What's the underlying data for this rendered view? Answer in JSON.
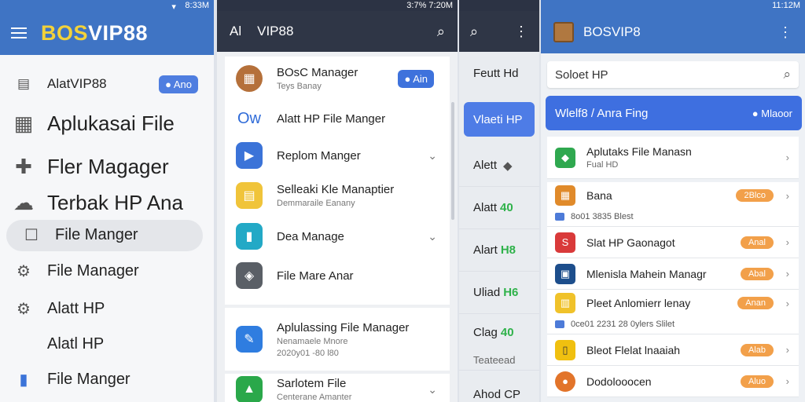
{
  "panel1": {
    "status_time": "8:33M",
    "brand": {
      "part1": "BOS",
      "part2": "VIP88"
    },
    "items": [
      {
        "label": "AlatVIP88",
        "icon": "briefcase-icon",
        "chip": "Ano"
      },
      {
        "label": "Aplukasai File",
        "icon": "clipboard-icon"
      },
      {
        "label": "Fler Magager",
        "icon": "puzzle-icon"
      },
      {
        "label": "Terbak HP Ana",
        "icon": "cloud-icon"
      },
      {
        "label": "File Manger",
        "icon": "square-icon"
      },
      {
        "label": "File Manager",
        "icon": "gear-icon"
      },
      {
        "label": "Alatt HP",
        "icon": "gear-icon"
      },
      {
        "label": "Alatl HP",
        "icon": ""
      },
      {
        "label": "File Manger",
        "icon": "bar-icon"
      }
    ]
  },
  "panel2": {
    "status_time": "3:7% 7:20M",
    "title_left": "Al",
    "title": "VIP88",
    "rows": [
      {
        "main": "BOsC Manager",
        "sub": "Teys Banay",
        "chip": "Ain",
        "icon": "crate-icon",
        "color": "#b5703a"
      },
      {
        "main": "Alatt HP File Manger",
        "icon_text": "Ow",
        "icon": "text-icon",
        "color": "#ffffff"
      },
      {
        "main": "Replom Manger",
        "icon": "play-icon",
        "color": "#3b73d8",
        "chevron": "⌄"
      },
      {
        "main": "Selleaki Kle Manaptier",
        "sub": "Demmaraile Eanany",
        "icon": "folder-icon",
        "color": "#f0c43a"
      },
      {
        "main": "Dea Manage",
        "icon": "bookmark-icon",
        "color": "#23a9c6",
        "chevron": "⌄"
      },
      {
        "main": "File Mare Anar",
        "icon": "shield-icon",
        "color": "#5a5f66"
      },
      {
        "main": "Aplulassing File Manager",
        "sub": "Nenamaele Mnore",
        "sub2": "2020y01 -80 l80",
        "icon": "pen-icon",
        "color": "#2f7de0"
      },
      {
        "main": "Sarlotem File",
        "sub": "Centerane Amanter",
        "icon": "drive-icon",
        "color": "#2aa84a",
        "chevron": "⌄"
      }
    ]
  },
  "panel3": {
    "search_icon": "search-icon",
    "rows_top": "Feutt Hd",
    "selected": "Vlaeti HP",
    "rows": [
      {
        "label": "Alett",
        "green": ""
      },
      {
        "label": "Alatt",
        "green": "40"
      },
      {
        "label": "Alart",
        "green": "H8"
      },
      {
        "label": "Uliad",
        "green": "H6"
      },
      {
        "label": "Clag",
        "green": "40"
      },
      {
        "label": "Teateead",
        "green": ""
      },
      {
        "label": "Ahod CP",
        "green": ""
      }
    ]
  },
  "panel4": {
    "status_time": "11:12M",
    "title": "BOSVIP8",
    "search_value": "Soloet HP",
    "banner": {
      "label": "Wlelf8 / Anra Fing",
      "action": "Mlaoor"
    },
    "rows": [
      {
        "main": "Aplutaks File Manasn",
        "sub": "Fual HD",
        "icon": "diamond-icon",
        "color": "#2fa84f"
      },
      {
        "main": "Bana",
        "badge": "2Blco",
        "icon": "apps-icon",
        "color": "#e08a2a"
      },
      {
        "subline": "8o01 3835 Blest"
      },
      {
        "main": "Slat HP Gaonagot",
        "badge": "Anal",
        "icon": "s-icon",
        "color": "#d93a3a"
      },
      {
        "main": "Mlenisla Mahein Managr",
        "badge": "Abal",
        "icon": "window-icon",
        "color": "#1d4e8c"
      },
      {
        "main": "Pleet Anlomierr lenay",
        "badge": "Anan",
        "icon": "grid-icon",
        "color": "#f0c22a"
      },
      {
        "subline": "0ce01 2231 28 0ylers Slilet"
      },
      {
        "main": "Bleot Flelat lnaaiah",
        "badge": "Alab",
        "icon": "phone-icon",
        "color": "#f0c010"
      },
      {
        "main": "Dodolooocen",
        "badge": "Aluo",
        "icon": "circle-icon",
        "color": "#e2742a"
      }
    ]
  }
}
